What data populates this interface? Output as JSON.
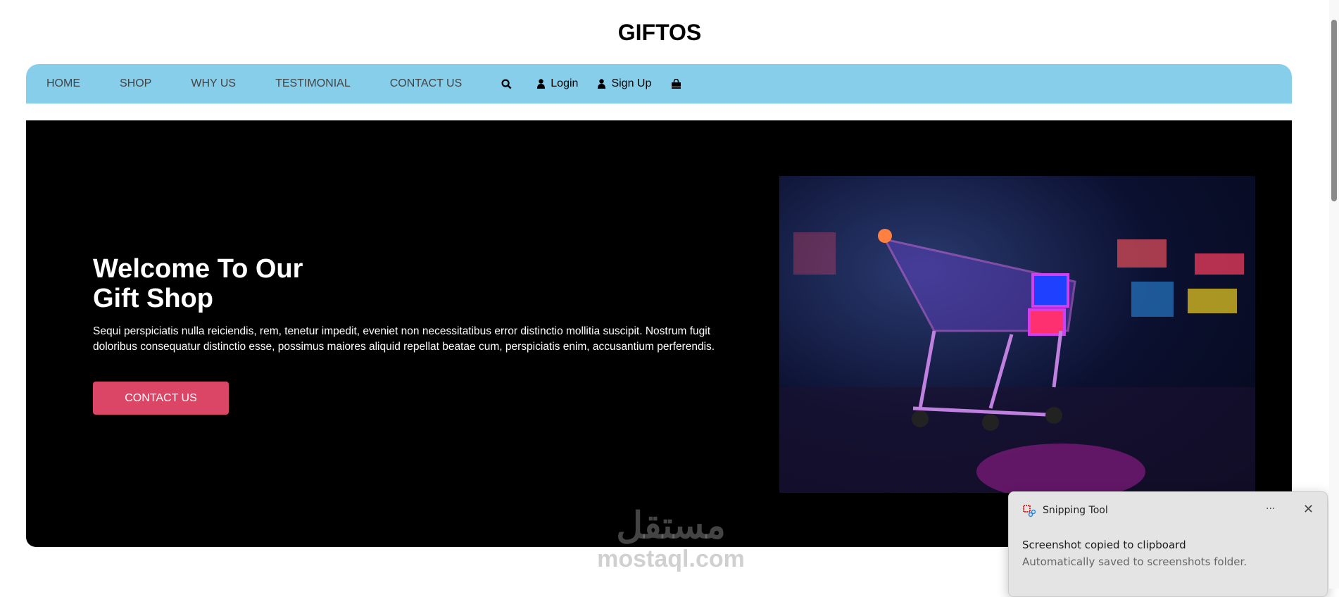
{
  "brand": "GIFTOS",
  "nav": {
    "items": [
      "HOME",
      "SHOP",
      "WHY US",
      "TESTIMONIAL",
      "CONTACT US"
    ],
    "login": "Login",
    "signup": "Sign Up"
  },
  "hero": {
    "title_line1": "Welcome To Our",
    "title_line2": "Gift Shop",
    "text": "Sequi perspiciatis nulla reiciendis, rem, tenetur impedit, eveniet non necessitatibus error distinctio mollitia suscipit. Nostrum fugit doloribus consequatur distinctio esse, possimus maiores aliquid repellat beatae cum, perspiciatis enim, accusantium perferendis.",
    "button": "CONTACT US"
  },
  "watermark": {
    "arabic": "مستقل",
    "latin": "mostaql.com"
  },
  "toast": {
    "app": "Snipping Tool",
    "title": "Screenshot copied to clipboard",
    "body": "Automatically saved to screenshots folder.",
    "more": "···"
  }
}
